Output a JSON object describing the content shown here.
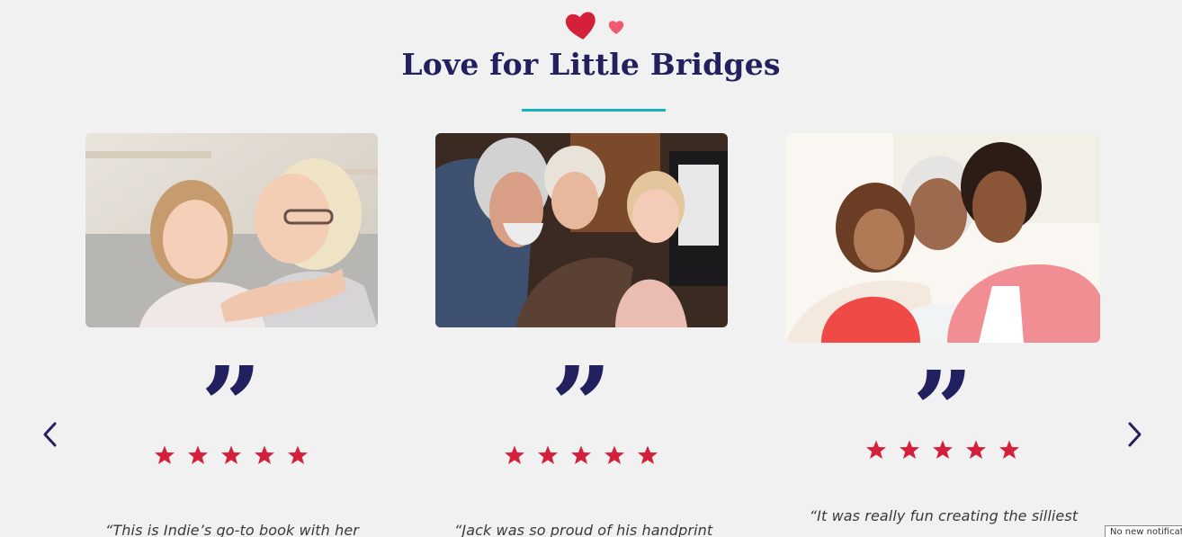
{
  "section": {
    "title": "Love for Little Bridges",
    "accent_color": "#16b2c2",
    "title_color": "#22205e",
    "heart_colors": [
      "#d4203a",
      "#f05a73"
    ]
  },
  "carousel": {
    "prev_icon": "chevron-left-icon",
    "next_icon": "chevron-right-icon",
    "testimonials": [
      {
        "photo_alt": "Grandmother hugging granddaughter on a sofa",
        "quote_mark": "”",
        "rating": 5,
        "text": "“This is Indie’s go-to book with her"
      },
      {
        "photo_alt": "Grandparents laughing with a toddler in the kitchen",
        "quote_mark": "”",
        "rating": 5,
        "text": "“Jack was so proud of his handprint"
      },
      {
        "photo_alt": "Girl, mother and grandmother smiling together",
        "quote_mark": "”",
        "rating": 5,
        "text": "“It was really fun creating the silliest"
      }
    ],
    "star_color": "#d4203a"
  },
  "system": {
    "notification": "No new notifications"
  }
}
